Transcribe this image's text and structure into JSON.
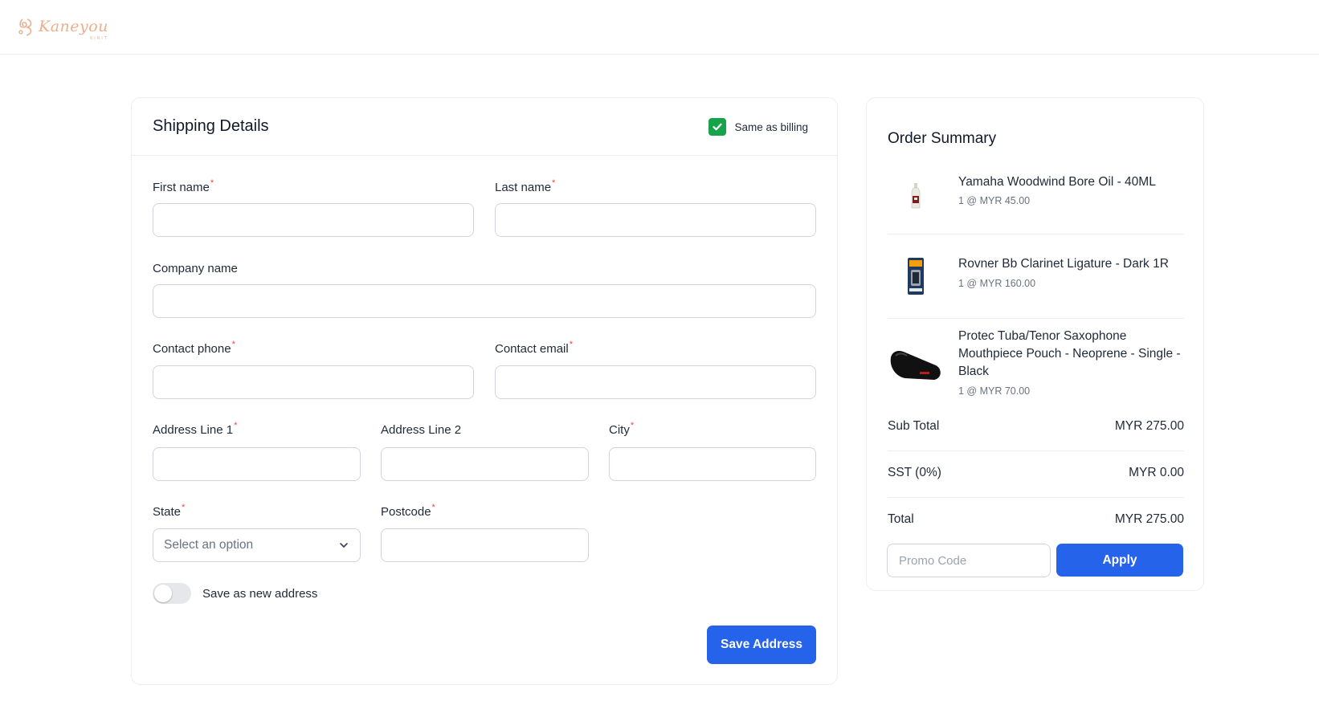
{
  "brand": {
    "logo_text": "Kaneyou",
    "logo_sub": "KIRIT"
  },
  "shipping": {
    "title": "Shipping Details",
    "same_as_billing_label": "Same as billing",
    "same_as_billing_checked": true,
    "fields": {
      "first_name": {
        "label": "First name",
        "value": ""
      },
      "last_name": {
        "label": "Last name",
        "value": ""
      },
      "company_name": {
        "label": "Company name",
        "value": ""
      },
      "contact_phone": {
        "label": "Contact phone",
        "value": ""
      },
      "contact_email": {
        "label": "Contact email",
        "value": ""
      },
      "address_line_1": {
        "label": "Address Line 1",
        "value": ""
      },
      "address_line_2": {
        "label": "Address Line 2",
        "value": ""
      },
      "city": {
        "label": "City",
        "value": ""
      },
      "state": {
        "label": "State",
        "placeholder": "Select an option"
      },
      "postcode": {
        "label": "Postcode",
        "value": ""
      }
    },
    "required_mark": "*",
    "save_new_address_label": "Save as new address",
    "save_new_address_on": false,
    "save_button": "Save Address"
  },
  "summary": {
    "title": "Order Summary",
    "items": [
      {
        "name": "Yamaha Woodwind Bore Oil - 40ML",
        "meta": "1 @ MYR 45.00"
      },
      {
        "name": "Rovner Bb Clarinet Ligature - Dark 1R",
        "meta": "1 @ MYR 160.00"
      },
      {
        "name": "Protec Tuba/Tenor Saxophone Mouthpiece Pouch - Neoprene - Single - Black",
        "meta": "1 @ MYR 70.00"
      }
    ],
    "subtotal_label": "Sub Total",
    "subtotal_value": "MYR 275.00",
    "sst_label": "SST (0%)",
    "sst_value": "MYR 0.00",
    "total_label": "Total",
    "total_value": "MYR 275.00",
    "promo_placeholder": "Promo Code",
    "apply_button": "Apply"
  },
  "colors": {
    "primary": "#2563eb",
    "check": "#16a34a",
    "required": "#ef4444",
    "brand": "#eab08e"
  }
}
